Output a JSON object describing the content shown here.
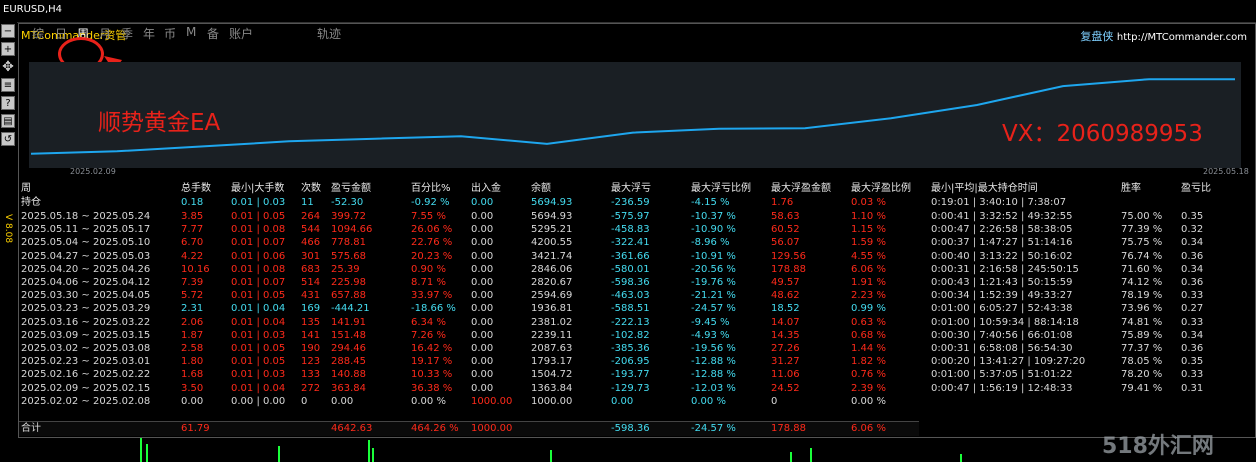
{
  "window_title": "EURUSD,H4",
  "app_title": "MTCommander资管",
  "brand": {
    "name": "复盘侠",
    "url": "http://MTCommander.com"
  },
  "version": "V 8.08",
  "tabs": [
    {
      "label": "综",
      "active": false
    },
    {
      "label": "日",
      "active": false
    },
    {
      "label": "周",
      "active": true
    },
    {
      "label": "月",
      "active": false
    },
    {
      "label": "季",
      "active": false
    },
    {
      "label": "年",
      "active": false
    },
    {
      "label": "币",
      "active": false
    },
    {
      "label": "M",
      "active": false
    },
    {
      "label": "备",
      "active": false
    },
    {
      "label": "账户",
      "active": false
    },
    {
      "label": "轨迹",
      "active": false
    }
  ],
  "toolbar_icons": [
    "minus-icon",
    "plus-icon",
    "move-icon",
    "list-icon",
    "help-icon",
    "save-icon",
    "reset-icon"
  ],
  "annotations": {
    "left": "顺势黄金EA",
    "right": "VX：2060989953"
  },
  "chart_data": {
    "type": "line",
    "x_start": "2025.02.09",
    "x_end": "2025.05.18",
    "x": [
      "2025.02.09",
      "2025.02.16",
      "2025.02.23",
      "2025.03.02",
      "2025.03.09",
      "2025.03.16",
      "2025.03.23",
      "2025.03.30",
      "2025.04.06",
      "2025.04.13",
      "2025.04.20",
      "2025.04.27",
      "2025.05.04",
      "2025.05.11",
      "2025.05.18"
    ],
    "values": [
      1363.84,
      1504.72,
      1793.17,
      2087.63,
      2239.11,
      2381.02,
      1936.81,
      2594.69,
      2820.67,
      2846.06,
      3421.74,
      4200.55,
      5295.21,
      5694.93,
      5694.93
    ],
    "color": "#1ea6ee"
  },
  "table": {
    "headers": [
      "周",
      "总手数",
      "最小|大手数",
      "次数",
      "盈亏金额",
      "百分比%",
      "出入金",
      "余额",
      "最大浮亏",
      "最大浮亏比例",
      "最大浮盈金额",
      "最大浮盈比例",
      "最小|平均|最大持仓时间",
      "胜率",
      "盈亏比"
    ],
    "holding": [
      "持仓",
      "0.18",
      "0.01 | 0.03",
      "11",
      "-52.30",
      "-0.92 %",
      "0.00",
      "5694.93",
      "-236.59",
      "-4.15 %",
      "1.76",
      "0.03 %",
      "0:19:01 | 3:40:10 | 7:38:07",
      "",
      ""
    ],
    "rows": [
      [
        "2025.05.18 ~ 2025.05.24",
        "3.85",
        "0.01 | 0.05",
        "264",
        "399.72",
        "7.55 %",
        "0.00",
        "5694.93",
        "-575.97",
        "-10.37 %",
        "58.63",
        "1.10 %",
        "0:00:41 | 3:32:52 | 49:32:55",
        "75.00 %",
        "0.35"
      ],
      [
        "2025.05.11 ~ 2025.05.17",
        "7.77",
        "0.01 | 0.08",
        "544",
        "1094.66",
        "26.06 %",
        "0.00",
        "5295.21",
        "-458.83",
        "-10.90 %",
        "60.52",
        "1.15 %",
        "0:00:47 | 2:26:58 | 58:38:05",
        "77.39 %",
        "0.32"
      ],
      [
        "2025.05.04 ~ 2025.05.10",
        "6.70",
        "0.01 | 0.07",
        "466",
        "778.81",
        "22.76 %",
        "0.00",
        "4200.55",
        "-322.41",
        "-8.96 %",
        "56.07",
        "1.59 %",
        "0:00:37 | 1:47:27 | 51:14:16",
        "75.75 %",
        "0.34"
      ],
      [
        "2025.04.27 ~ 2025.05.03",
        "4.22",
        "0.01 | 0.06",
        "301",
        "575.68",
        "20.23 %",
        "0.00",
        "3421.74",
        "-361.66",
        "-10.91 %",
        "129.56",
        "4.55 %",
        "0:00:40 | 3:13:22 | 50:16:02",
        "76.74 %",
        "0.36"
      ],
      [
        "2025.04.20 ~ 2025.04.26",
        "10.16",
        "0.01 | 0.08",
        "683",
        "25.39",
        "0.90 %",
        "0.00",
        "2846.06",
        "-580.01",
        "-20.56 %",
        "178.88",
        "6.06 %",
        "0:00:31 | 2:16:58 | 245:50:15",
        "71.60 %",
        "0.34"
      ],
      [
        "2025.04.06 ~ 2025.04.12",
        "7.39",
        "0.01 | 0.07",
        "514",
        "225.98",
        "8.71 %",
        "0.00",
        "2820.67",
        "-598.36",
        "-19.76 %",
        "49.57",
        "1.91 %",
        "0:00:43 | 1:21:43 | 50:15:59",
        "74.12 %",
        "0.36"
      ],
      [
        "2025.03.30 ~ 2025.04.05",
        "5.72",
        "0.01 | 0.05",
        "431",
        "657.88",
        "33.97 %",
        "0.00",
        "2594.69",
        "-463.03",
        "-21.21 %",
        "48.62",
        "2.23 %",
        "0:00:34 | 1:52:39 | 49:33:27",
        "78.19 %",
        "0.33"
      ],
      [
        "2025.03.23 ~ 2025.03.29",
        "2.31",
        "0.01 | 0.04",
        "169",
        "-444.21",
        "-18.66 %",
        "0.00",
        "1936.81",
        "-588.51",
        "-24.57 %",
        "18.52",
        "0.99 %",
        "0:01:00 | 6:05:27 | 52:43:38",
        "73.96 %",
        "0.27"
      ],
      [
        "2025.03.16 ~ 2025.03.22",
        "2.06",
        "0.01 | 0.04",
        "135",
        "141.91",
        "6.34 %",
        "0.00",
        "2381.02",
        "-222.13",
        "-9.45 %",
        "14.07",
        "0.63 %",
        "0:01:00 | 10:59:34 | 88:14:18",
        "74.81 %",
        "0.33"
      ],
      [
        "2025.03.09 ~ 2025.03.15",
        "1.87",
        "0.01 | 0.03",
        "141",
        "151.48",
        "7.26 %",
        "0.00",
        "2239.11",
        "-102.82",
        "-4.93 %",
        "14.35",
        "0.68 %",
        "0:00:30 | 7:40:56 | 66:01:08",
        "75.89 %",
        "0.34"
      ],
      [
        "2025.03.02 ~ 2025.03.08",
        "2.58",
        "0.01 | 0.05",
        "190",
        "294.46",
        "16.42 %",
        "0.00",
        "2087.63",
        "-385.36",
        "-19.56 %",
        "27.26",
        "1.44 %",
        "0:00:31 | 6:58:08 | 56:54:30",
        "77.37 %",
        "0.36"
      ],
      [
        "2025.02.23 ~ 2025.03.01",
        "1.80",
        "0.01 | 0.05",
        "123",
        "288.45",
        "19.17 %",
        "0.00",
        "1793.17",
        "-206.95",
        "-12.88 %",
        "31.27",
        "1.82 %",
        "0:00:20 | 13:41:27 | 109:27:20",
        "78.05 %",
        "0.35"
      ],
      [
        "2025.02.16 ~ 2025.02.22",
        "1.68",
        "0.01 | 0.03",
        "133",
        "140.88",
        "10.33 %",
        "0.00",
        "1504.72",
        "-193.77",
        "-12.88 %",
        "11.06",
        "0.76 %",
        "0:01:00 | 5:37:05 | 51:01:22",
        "78.20 %",
        "0.33"
      ],
      [
        "2025.02.09 ~ 2025.02.15",
        "3.50",
        "0.01 | 0.04",
        "272",
        "363.84",
        "36.38 %",
        "0.00",
        "1363.84",
        "-129.73",
        "-12.03 %",
        "24.52",
        "2.39 %",
        "0:00:47 | 1:56:19 | 12:48:33",
        "79.41 %",
        "0.31"
      ],
      [
        "2025.02.02 ~ 2025.02.08",
        "0.00",
        "0.00 | 0.00",
        "0",
        "0.00",
        "0.00 %",
        "1000.00",
        "1000.00",
        "0.00",
        "0.00 %",
        "0",
        "0.00 %",
        "",
        "",
        ""
      ]
    ],
    "total": [
      "合计",
      "61.79",
      "",
      "",
      "4642.63",
      "464.26 %",
      "1000.00",
      "",
      "-598.36",
      "-24.57 %",
      "178.88",
      "6.06 %",
      "",
      "",
      ""
    ]
  },
  "watermark": "518外汇网"
}
